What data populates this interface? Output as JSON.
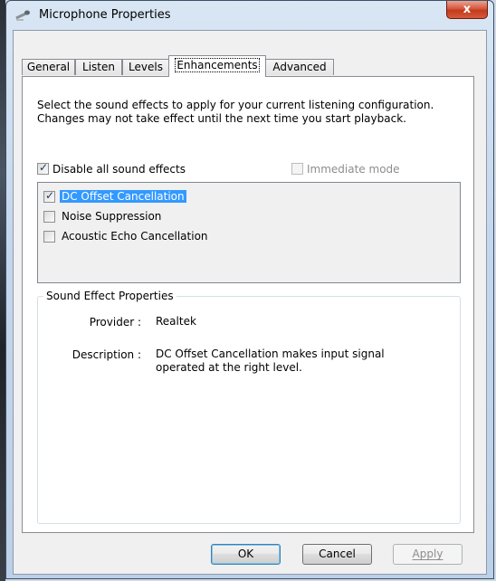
{
  "window": {
    "title": "Microphone Properties",
    "close_glyph": "x"
  },
  "tabs": [
    {
      "label": "General"
    },
    {
      "label": "Listen"
    },
    {
      "label": "Levels"
    },
    {
      "label": "Enhancements",
      "active": true
    },
    {
      "label": "Advanced"
    }
  ],
  "enhancements": {
    "description": "Select the sound effects to apply for your current listening configuration. Changes may not take effect until the next time you start playback.",
    "disable_all": {
      "label": "Disable all sound effects",
      "checked": true
    },
    "immediate_mode": {
      "label": "Immediate mode",
      "checked": false,
      "enabled": false
    },
    "effects": [
      {
        "label": "DC Offset Cancellation",
        "checked": true,
        "selected": true
      },
      {
        "label": "Noise Suppression",
        "checked": false
      },
      {
        "label": "Acoustic Echo Cancellation",
        "checked": false
      }
    ],
    "properties": {
      "title": "Sound Effect Properties",
      "provider_label": "Provider :",
      "provider_value": "Realtek",
      "description_label": "Description :",
      "description_value": "DC Offset Cancellation makes input signal operated at the right level."
    }
  },
  "buttons": {
    "ok": "OK",
    "cancel": "Cancel",
    "apply": "Apply"
  },
  "colors": {
    "selection": "#3399ff",
    "close_button": "#c23a1e"
  }
}
